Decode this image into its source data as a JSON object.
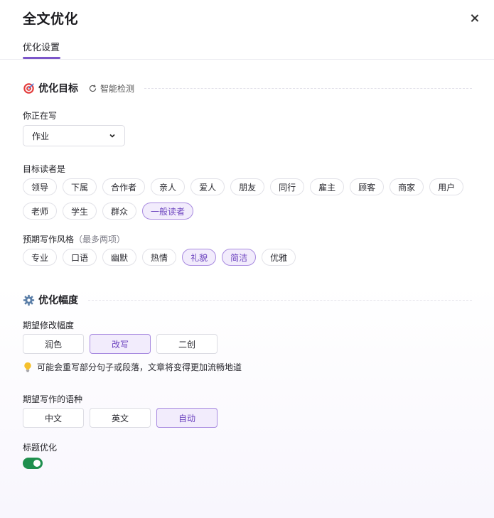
{
  "header": {
    "title": "全文优化"
  },
  "tabs": [
    {
      "label": "优化设置"
    }
  ],
  "goal_section": {
    "title": "优化目标",
    "detect_label": "智能检测",
    "writing_label": "你正在写",
    "writing_value": "作业",
    "readers_label": "目标读者是",
    "readers": [
      "领导",
      "下属",
      "合作者",
      "亲人",
      "爱人",
      "朋友",
      "同行",
      "雇主",
      "顾客",
      "商家",
      "用户",
      "老师",
      "学生",
      "群众",
      "一般读者"
    ],
    "readers_selected": [
      "一般读者"
    ],
    "style_label": "预期写作风格",
    "style_note": "（最多两项）",
    "styles": [
      "专业",
      "口语",
      "幽默",
      "热情",
      "礼貌",
      "简洁",
      "优雅"
    ],
    "styles_selected": [
      "礼貌",
      "简洁"
    ]
  },
  "degree_section": {
    "title": "优化幅度",
    "degree_label": "期望修改幅度",
    "degrees": [
      "润色",
      "改写",
      "二创"
    ],
    "degree_selected": "改写",
    "tip": "可能会重写部分句子或段落，文章将变得更加流畅地道",
    "language_label": "期望写作的语种",
    "languages": [
      "中文",
      "英文",
      "自动"
    ],
    "language_selected": "自动",
    "title_opt_label": "标题优化",
    "title_opt_on": true
  },
  "colors": {
    "accent": "#7c56c9",
    "accent_bg": "#f2ecfc",
    "toggle_on": "#1f8f4e"
  }
}
